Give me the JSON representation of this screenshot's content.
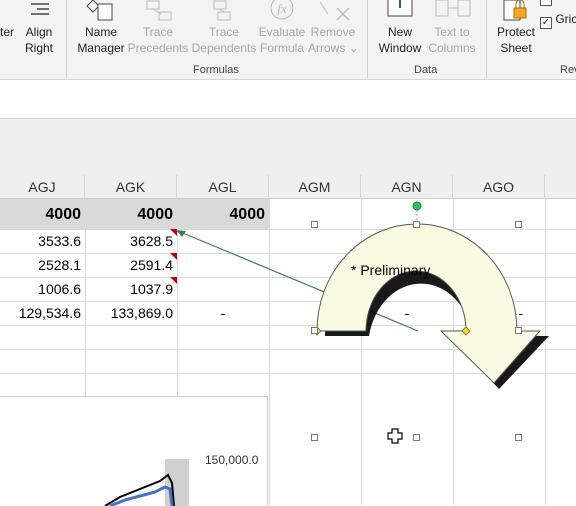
{
  "ribbon": {
    "buttons": {
      "center": "ter",
      "align_right": [
        "Align",
        "Right"
      ],
      "name_manager": [
        "Name",
        "Manager"
      ],
      "trace_precedents": [
        "Trace",
        "Precedents"
      ],
      "trace_dependents": [
        "Trace",
        "Dependents"
      ],
      "evaluate_formula": [
        "Evaluate",
        "Formula"
      ],
      "remove_arrows": [
        "Remove",
        "Arrows ⌄"
      ],
      "new_window": [
        "New",
        "Window"
      ],
      "text_to_columns": [
        "Text to",
        "Columns"
      ],
      "protect_sheet": [
        "Protect",
        "Sheet"
      ],
      "gridlines": "Gric",
      "review": "Rev"
    },
    "groups": {
      "formulas": "Formulas",
      "data": "Data"
    }
  },
  "columns": [
    "AGJ",
    "AGK",
    "AGL",
    "AGM",
    "AGN",
    "AGO"
  ],
  "rows": [
    [
      "4000",
      "4000",
      "4000"
    ],
    [
      "3533.6",
      "3628.5",
      ""
    ],
    [
      "2528.1",
      "2591.4",
      ""
    ],
    [
      "1006.6",
      "1037.9",
      ""
    ],
    [
      "129,534.6",
      "133,869.0",
      "-"
    ]
  ],
  "overflow": {
    "agn_dash": "-",
    "ago_dash": "-"
  },
  "shape": {
    "text": "*  Preliminary",
    "fill": "#fbfbe3"
  },
  "chart": {
    "axis_label": "150,000.0"
  },
  "colors": {
    "ribbon_bg": "#f3f3f3",
    "header_bg": "#efefef",
    "arrow_line": "#3f7f5f",
    "comment_mark": "#c00000",
    "rotation_handle": "#22c55e"
  }
}
